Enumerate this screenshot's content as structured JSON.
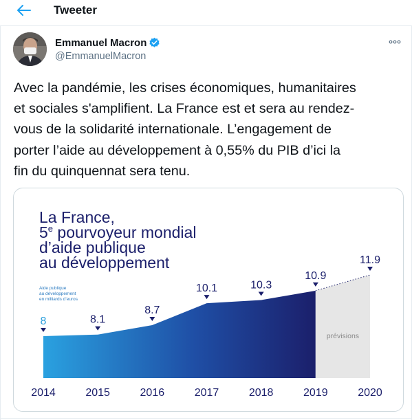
{
  "header": {
    "title": "Tweeter",
    "back_icon": "arrow-left-icon"
  },
  "tweet": {
    "author_name": "Emmanuel Macron",
    "handle": "@EmmanuelMacron",
    "verified_icon": "verified-badge-icon",
    "more_icon": "more-horizontal-icon",
    "text": "Avec la pandémie, les crises économiques, humanitaires\net sociales s'amplifient. La France est et sera au rendez-\nvous de la solidarité internationale. L’engagement de\nporter l’aide au développement à 0,55% du PIB d’ici la\nfin du quinquennat sera tenu."
  },
  "colors": {
    "accent": "#1da1f2",
    "chart_dark": "#1b1f6b",
    "chart_light": "#2aa1e0",
    "forecast": "#e6e6e6"
  },
  "chart_data": {
    "type": "area",
    "title_lines": [
      "La France,",
      "5e pourvoyeur mondial",
      "d’aide publique",
      "au développement"
    ],
    "title_superscript": "e",
    "ylabel_lines": [
      "Aide publique",
      "au développement",
      "en milliards d’euros"
    ],
    "forecast_label": "prévisions",
    "x": [
      "2014",
      "2015",
      "2016",
      "2017",
      "2018",
      "2019",
      "2020"
    ],
    "values": [
      8,
      8.1,
      8.7,
      10.1,
      10.3,
      10.9,
      11.9
    ],
    "value_labels": [
      "8",
      "8.1",
      "8.7",
      "10.1",
      "10.3",
      "10.9",
      "11.9"
    ],
    "forecast_from": "2019",
    "forecast_to": "2020"
  }
}
